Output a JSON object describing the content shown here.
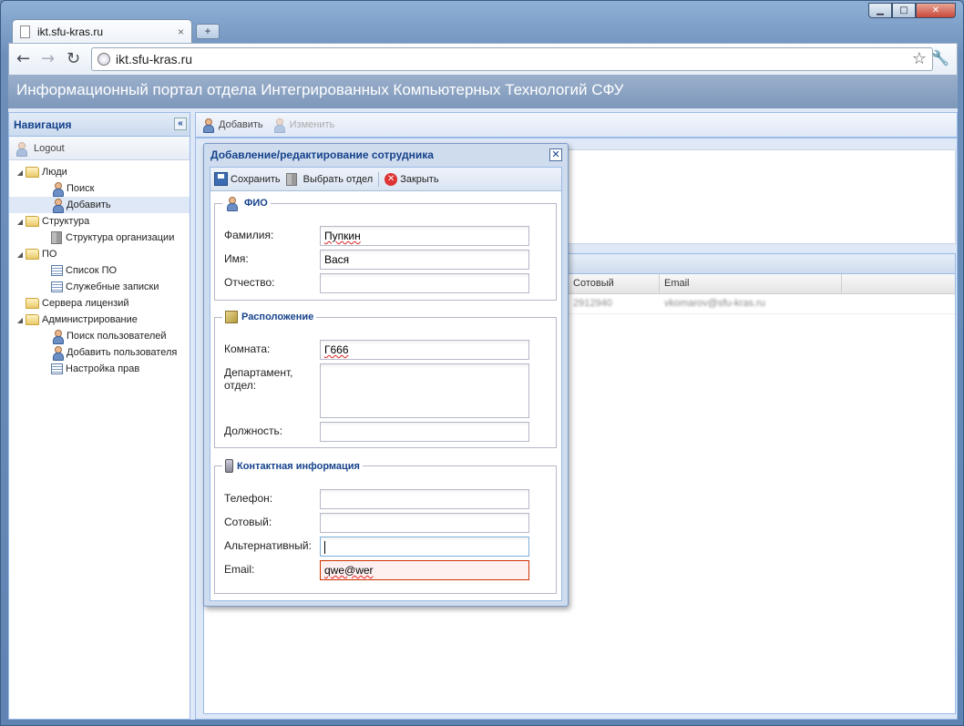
{
  "browser": {
    "tab_title": "ikt.sfu-kras.ru",
    "tab_close": "×",
    "new_tab": "+",
    "address": "ikt.sfu-kras.ru",
    "back_glyph": "←",
    "forward_glyph": "→",
    "reload_glyph": "↻",
    "star_glyph": "☆",
    "wrench_glyph": "🔧",
    "minimize_glyph": "▁",
    "maximize_glyph": "□",
    "close_glyph": "✕"
  },
  "portal": {
    "header_title": "Информационный портал отдела Интегрированных Компьютерных Технологий СФУ"
  },
  "navigation": {
    "title": "Навигация",
    "collapse_glyph": "«",
    "logout_label": "Logout",
    "items": [
      {
        "label": "Люди",
        "level": 0,
        "type": "folder",
        "expanded": true
      },
      {
        "label": "Поиск",
        "level": 1,
        "type": "user"
      },
      {
        "label": "Добавить",
        "level": 1,
        "type": "user",
        "selected": true
      },
      {
        "label": "Структура",
        "level": 0,
        "type": "folder",
        "expanded": true
      },
      {
        "label": "Структура организации",
        "level": 1,
        "type": "building"
      },
      {
        "label": "ПО",
        "level": 0,
        "type": "folder",
        "expanded": true
      },
      {
        "label": "Список ПО",
        "level": 1,
        "type": "list"
      },
      {
        "label": "Служебные записки",
        "level": 1,
        "type": "list"
      },
      {
        "label": "Сервера лицензий",
        "level": 0,
        "type": "folder",
        "expanded": false
      },
      {
        "label": "Администрирование",
        "level": 0,
        "type": "folder",
        "expanded": true
      },
      {
        "label": "Поиск пользователей",
        "level": 1,
        "type": "user"
      },
      {
        "label": "Добавить пользователя",
        "level": 1,
        "type": "user"
      },
      {
        "label": "Настройка прав",
        "level": 1,
        "type": "list"
      }
    ]
  },
  "main_toolbar": {
    "add_label": "Добавить",
    "edit_label": "Изменить"
  },
  "grid": {
    "columns": [
      "Сотовый",
      "Email"
    ],
    "rows": [
      [
        "2912940",
        "vkomarov@sfu-kras.ru"
      ]
    ]
  },
  "dialog": {
    "title": "Добавление/редактирование сотрудника",
    "close_glyph": "✕",
    "toolbar": {
      "save_label": "Сохранить",
      "choose_dept_label": "Выбрать отдел",
      "close_label": "Закрыть",
      "close_icon_glyph": "✕"
    },
    "fio": {
      "legend": "ФИО",
      "surname_label": "Фамилия:",
      "surname_value": "Пупкин",
      "name_label": "Имя:",
      "name_value": "Вася",
      "patronymic_label": "Отчество:",
      "patronymic_value": ""
    },
    "location": {
      "legend": "Расположение",
      "room_label": "Комната:",
      "room_value": "Г666",
      "dept_label": "Департамент, отдел:",
      "dept_value": "",
      "position_label": "Должность:",
      "position_value": ""
    },
    "contact": {
      "legend": "Контактная информация",
      "phone_label": "Телефон:",
      "phone_value": "",
      "mobile_label": "Сотовый:",
      "mobile_value": "",
      "alt_label": "Альтернативный:",
      "alt_value": "",
      "email_label": "Email:",
      "email_value": "qwe@wer"
    }
  }
}
